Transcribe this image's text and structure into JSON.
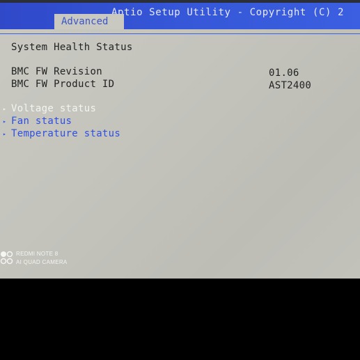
{
  "header": {
    "title": "Aptio Setup Utility - Copyright (C) 2",
    "active_tab": "Advanced"
  },
  "main": {
    "section_title": "System Health Status",
    "info_rows": [
      {
        "label": "BMC FW Revision",
        "value": "01.06"
      },
      {
        "label": "BMC FW Product ID",
        "value": "AST2400"
      }
    ],
    "menu_items": [
      {
        "label": "Voltage status",
        "selected": true
      },
      {
        "label": "Fan status",
        "selected": false
      },
      {
        "label": "Temperature status",
        "selected": false
      }
    ]
  },
  "watermark": {
    "line1": "REDMI NOTE 8",
    "line2": "AI QUAD CAMERA",
    "icon": "quad-camera-icon"
  },
  "colors": {
    "title_bar": "#3557d8",
    "screen_background": "#c4c4bd",
    "menu_link": "#2f4fe0",
    "selected_item": "#f4f4f0",
    "static_text": "#222222"
  }
}
